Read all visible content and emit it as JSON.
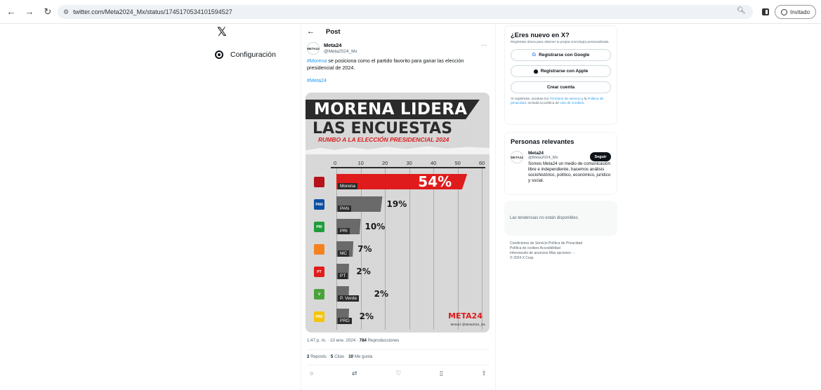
{
  "browser": {
    "url": "twitter.com/Meta2024_Mx/status/1745170534101594527",
    "profile_label": "Invitado"
  },
  "leftnav": {
    "logo": "𝕏",
    "settings_label": "Configuración"
  },
  "post": {
    "header_title": "Post",
    "author_name": "Meta24",
    "author_handle": "@Meta2024_Mx",
    "avatar_text": "META24",
    "text_hashtag": "#Morena",
    "text_body": " se posiciona como el partido favorito para ganar las elección presidencial de 2024.",
    "tag_line": "#Meta24",
    "timestamp": "1:47 p. m. · 10 ene. 2024 · ",
    "views_count": "784",
    "views_label": " Reproducciones",
    "reposts_count": "2",
    "reposts_label": "Reposts",
    "quotes_count": "5",
    "quotes_label": "Citas",
    "likes_count": "10",
    "likes_label": "Me gusta"
  },
  "graphic": {
    "title_line1": "MORENA LIDERA",
    "title_line2": "LAS ENCUESTAS",
    "subtitle": "RUMBO A LA ELECCIÓN PRESIDENCIAL 2024",
    "ticks": [
      "0",
      "10",
      "20",
      "30",
      "40",
      "50",
      "60"
    ],
    "logo": "META24",
    "footer": "Meta24  @Meta2024_Mx",
    "rows": [
      {
        "party": "Morena",
        "pct": "54%",
        "value": 54,
        "icon_color": "#b5121b",
        "icon_text": ""
      },
      {
        "party": "PAN",
        "pct": "19%",
        "value": 19,
        "icon_color": "#0b4ea2",
        "icon_text": "PAN"
      },
      {
        "party": "PRI",
        "pct": "10%",
        "value": 10,
        "icon_color": "#1e9c3c",
        "icon_text": "PRI"
      },
      {
        "party": "MC",
        "pct": "7%",
        "value": 7,
        "icon_color": "#f58220",
        "icon_text": ""
      },
      {
        "party": "PT",
        "pct": "2%",
        "value": 2,
        "icon_color": "#e01b1b",
        "icon_text": "PT"
      },
      {
        "party": "P. Verde",
        "pct": "2%",
        "value": 2,
        "icon_color": "#4aa33a",
        "icon_text": "V"
      },
      {
        "party": "PRD",
        "pct": "2%",
        "value": 2,
        "icon_color": "#f5c400",
        "icon_text": "PRD"
      }
    ]
  },
  "sidebar": {
    "new_title": "¿Eres nuevo en X?",
    "new_subtitle": "Regístrate ahora para obtener tu propia cronología personalizada.",
    "google_btn": "Registrarse con Google",
    "apple_btn": "Registrarse con Apple",
    "create_btn": "Crear cuenta",
    "legal_prefix": "Al registrarte, aceptas los ",
    "legal_terms": "Términos de servicio",
    "legal_mid": " y la ",
    "legal_privacy": "Política de privacidad",
    "legal_mid2": ", incluida la política de ",
    "legal_cookies": "Uso de Cookies",
    "legal_end": ".",
    "people_title": "Personas relevantes",
    "person_name": "Meta24",
    "person_handle": "@Meta2024_Mx",
    "person_bio": "Somos Meta24 un medio de comunicación libre e independiente, hacemos análisis sociohistórico, político, económico, jurídico y social.",
    "follow_btn": "Seguir",
    "trends_text": "Las tendencias no están disponibles.",
    "footer_lines": [
      "Condiciones de Servicio   Política de Privacidad",
      "Política de cookies   Accesibilidad",
      "Información de anuncios   Más opciones ···",
      "© 2024 X Corp."
    ]
  }
}
